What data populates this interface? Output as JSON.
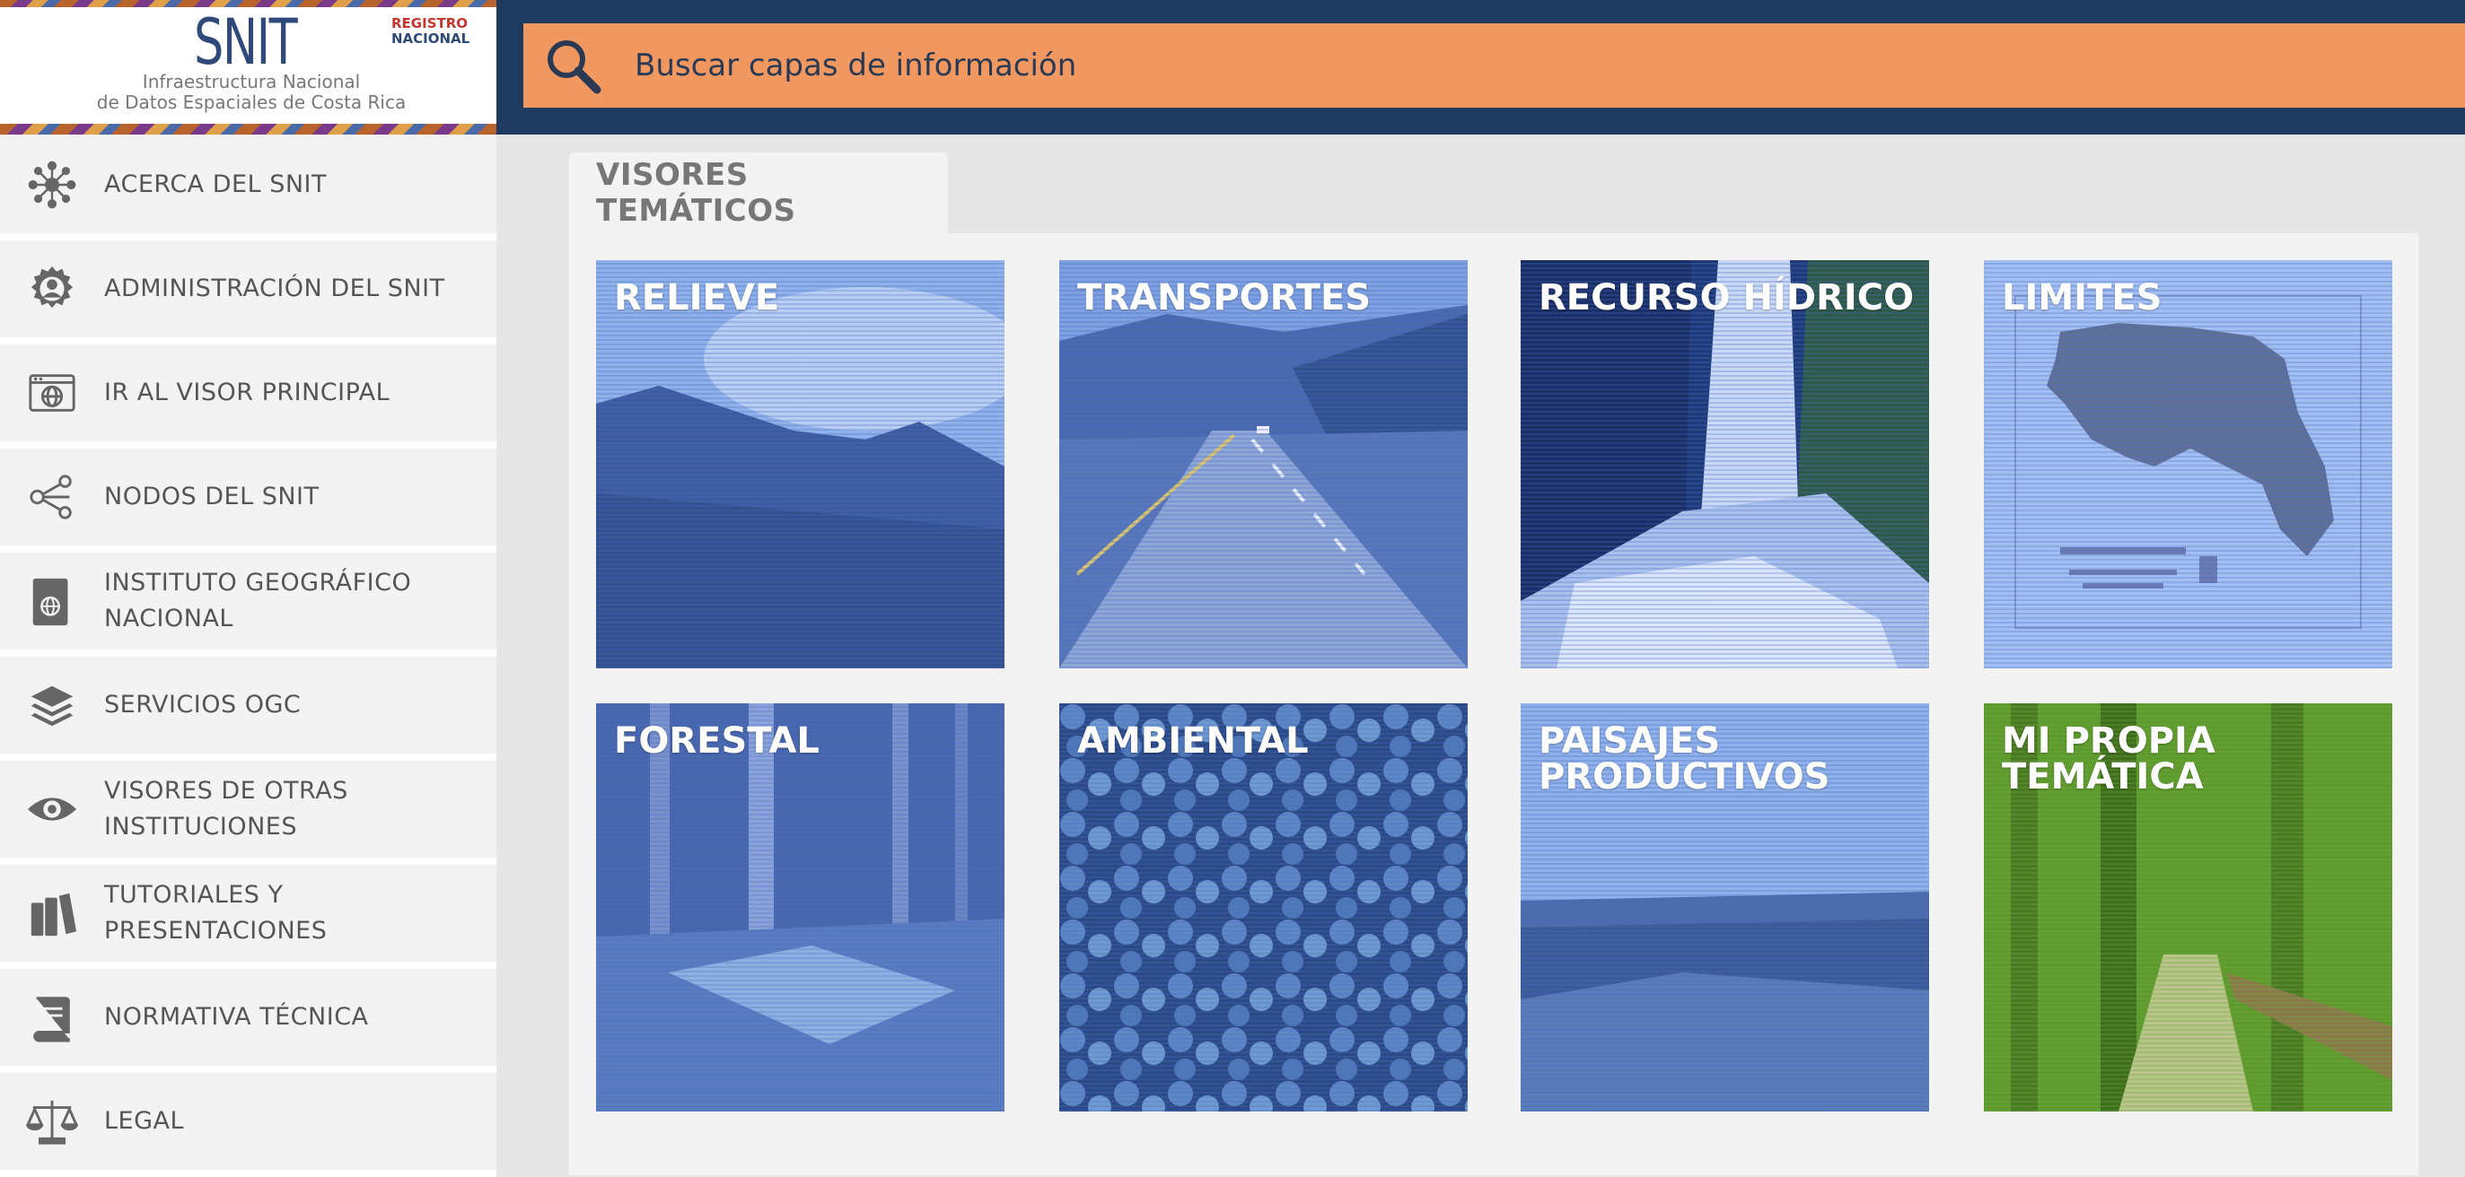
{
  "logo": {
    "title": "SNIT",
    "subtitle_line1": "Infraestructura Nacional",
    "subtitle_line2": "de Datos Espaciales de Costa Rica",
    "partner_line1": "REGISTRO",
    "partner_line2": "NACIONAL"
  },
  "search": {
    "placeholder": "Buscar capas de información",
    "icon": "search-icon"
  },
  "sidebar": {
    "items": [
      {
        "label": "ACERCA DEL SNIT",
        "icon": "network-icon"
      },
      {
        "label": "ADMINISTRACIÓN DEL SNIT",
        "icon": "gear-user-icon"
      },
      {
        "label": "IR AL VISOR PRINCIPAL",
        "icon": "browser-globe-icon"
      },
      {
        "label": "NODOS DEL SNIT",
        "icon": "share-nodes-icon"
      },
      {
        "label": "INSTITUTO GEOGRÁFICO NACIONAL",
        "icon": "globe-book-icon"
      },
      {
        "label": "SERVICIOS OGC",
        "icon": "layers-icon"
      },
      {
        "label": "VISORES DE OTRAS INSTITUCIONES",
        "icon": "eye-icon"
      },
      {
        "label": "TUTORIALES Y PRESENTACIONES",
        "icon": "books-icon"
      },
      {
        "label": "NORMATIVA TÉCNICA",
        "icon": "book-icon"
      },
      {
        "label": "LEGAL",
        "icon": "scales-icon"
      }
    ]
  },
  "main": {
    "tab_label": "VISORES TEMÁTICOS",
    "tiles": [
      {
        "title": "RELIEVE"
      },
      {
        "title": "TRANSPORTES"
      },
      {
        "title": "RECURSO HÍDRICO"
      },
      {
        "title": "LIMITES"
      },
      {
        "title": "FORESTAL"
      },
      {
        "title": "AMBIENTAL"
      },
      {
        "title": "PAISAJES PRODUCTIVOS"
      },
      {
        "title": "MI PROPIA TEMÁTICA"
      }
    ]
  },
  "colors": {
    "topbar": "#1f3a5f",
    "search_bg": "#f0985f",
    "sidebar_bg": "#f3f3f3",
    "tile_overlay": "#4a6ec8",
    "custom_tile_overlay": "#6aa83c"
  }
}
